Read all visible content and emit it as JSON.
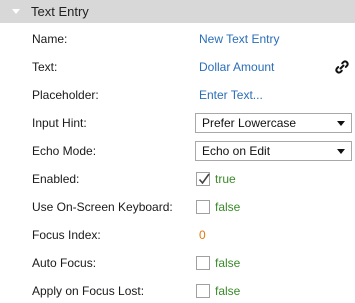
{
  "section": {
    "title": "Text Entry"
  },
  "properties": {
    "name": {
      "label": "Name:",
      "value": "New Text Entry"
    },
    "text": {
      "label": "Text:",
      "value": "Dollar Amount"
    },
    "placeholder": {
      "label": "Placeholder:",
      "value": "Enter Text..."
    },
    "input_hint": {
      "label": "Input Hint:",
      "value": "Prefer Lowercase"
    },
    "echo_mode": {
      "label": "Echo Mode:",
      "value": "Echo on Edit"
    },
    "enabled": {
      "label": "Enabled:",
      "checked": true,
      "value": "true"
    },
    "use_onscreen_keyboard": {
      "label": "Use On-Screen Keyboard:",
      "checked": false,
      "value": "false"
    },
    "focus_index": {
      "label": "Focus Index:",
      "value": "0"
    },
    "auto_focus": {
      "label": "Auto Focus:",
      "checked": false,
      "value": "false"
    },
    "apply_on_focus_lost": {
      "label": "Apply on Focus Lost:",
      "checked": false,
      "value": "false"
    }
  },
  "colors": {
    "link": "#2a6eb8",
    "bool": "#3a8a2a",
    "number": "#e07a10",
    "header_bg": "#d8d8d8"
  },
  "icons": {
    "binding": "link-icon",
    "collapse": "triangle-down-icon"
  }
}
